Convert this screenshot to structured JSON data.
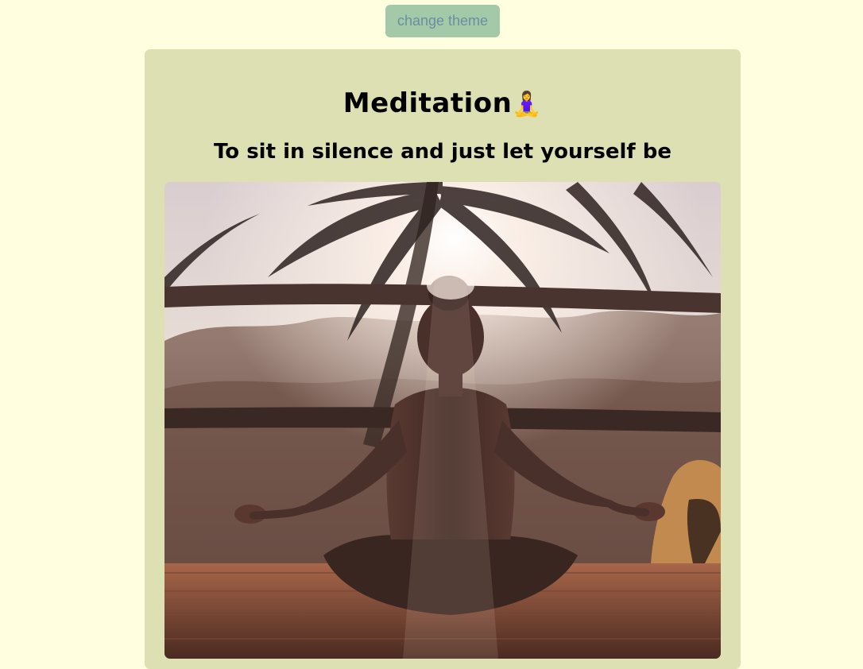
{
  "toolbar": {
    "theme_button_label": "change theme"
  },
  "card": {
    "title": "Meditation",
    "title_emoji": "🧘‍♀️",
    "subtitle": "To sit in silence and just let yourself be",
    "image": {
      "icon": "meditation-photo"
    }
  },
  "colors": {
    "page_bg": "#ffffdf",
    "card_bg": "#dde0b3",
    "button_bg": "#a3c9a8",
    "button_text": "#6c8ea2"
  }
}
